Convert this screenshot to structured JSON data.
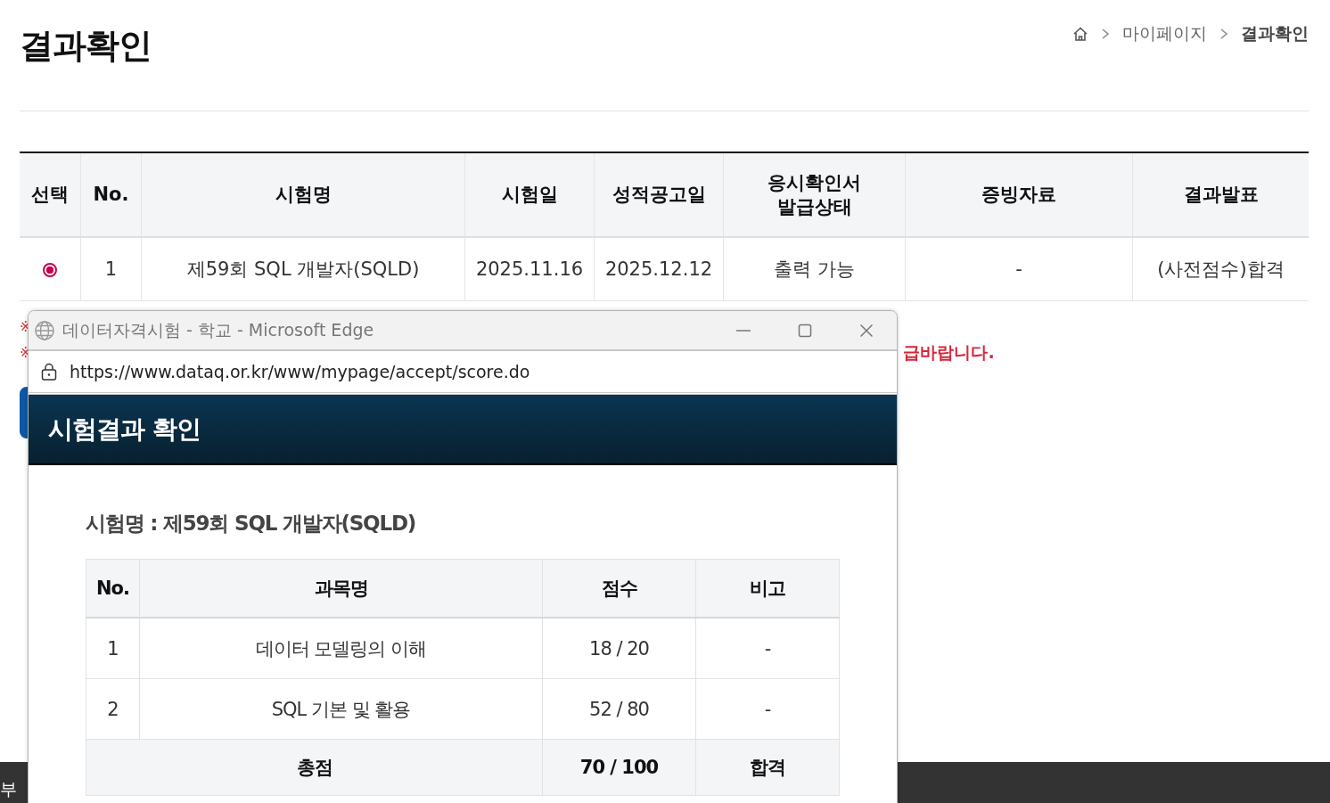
{
  "page": {
    "title": "결과확인",
    "breadcrumb": [
      "마이페이지",
      "결과확인"
    ]
  },
  "table": {
    "columns": [
      {
        "label": "선택"
      },
      {
        "label": "No."
      },
      {
        "label": "시험명"
      },
      {
        "label": "시험일"
      },
      {
        "label": "성적공고일"
      },
      {
        "label": "응시확인서\n발급상태"
      },
      {
        "label": "증빙자료"
      },
      {
        "label": "결과발표"
      }
    ],
    "rows": [
      {
        "cells": [
          {
            "kind": "radio",
            "selected": true
          },
          "1",
          "제59회 SQL 개발자(SQLD)",
          "2025.11.16",
          "2025.12.12",
          "출력 가능",
          "-",
          "(사전점수)합격"
        ]
      }
    ]
  },
  "notes": [
    {
      "mark": "※"
    },
    {
      "mark": "※",
      "tail": "급바랍니다."
    }
  ],
  "footer": {
    "text": "부"
  },
  "popup": {
    "window_title": "데이터자격시험 - 학교 - Microsoft Edge",
    "url": "https://www.dataq.or.kr/www/mypage/accept/score.do",
    "heading": "시험결과 확인",
    "exam_label": "시험명 : 제59회 SQL 개발자(SQLD)",
    "columns": [
      "No.",
      "과목명",
      "점수",
      "비고"
    ],
    "rows": [
      {
        "cells": [
          "1",
          "데이터 모델링의 이해",
          "18 / 20",
          "-"
        ]
      },
      {
        "cells": [
          "2",
          "SQL 기본 및 활용",
          "52 / 80",
          "-"
        ]
      }
    ],
    "total": {
      "label": "총점",
      "score": "70 / 100",
      "remark": "합격"
    }
  }
}
